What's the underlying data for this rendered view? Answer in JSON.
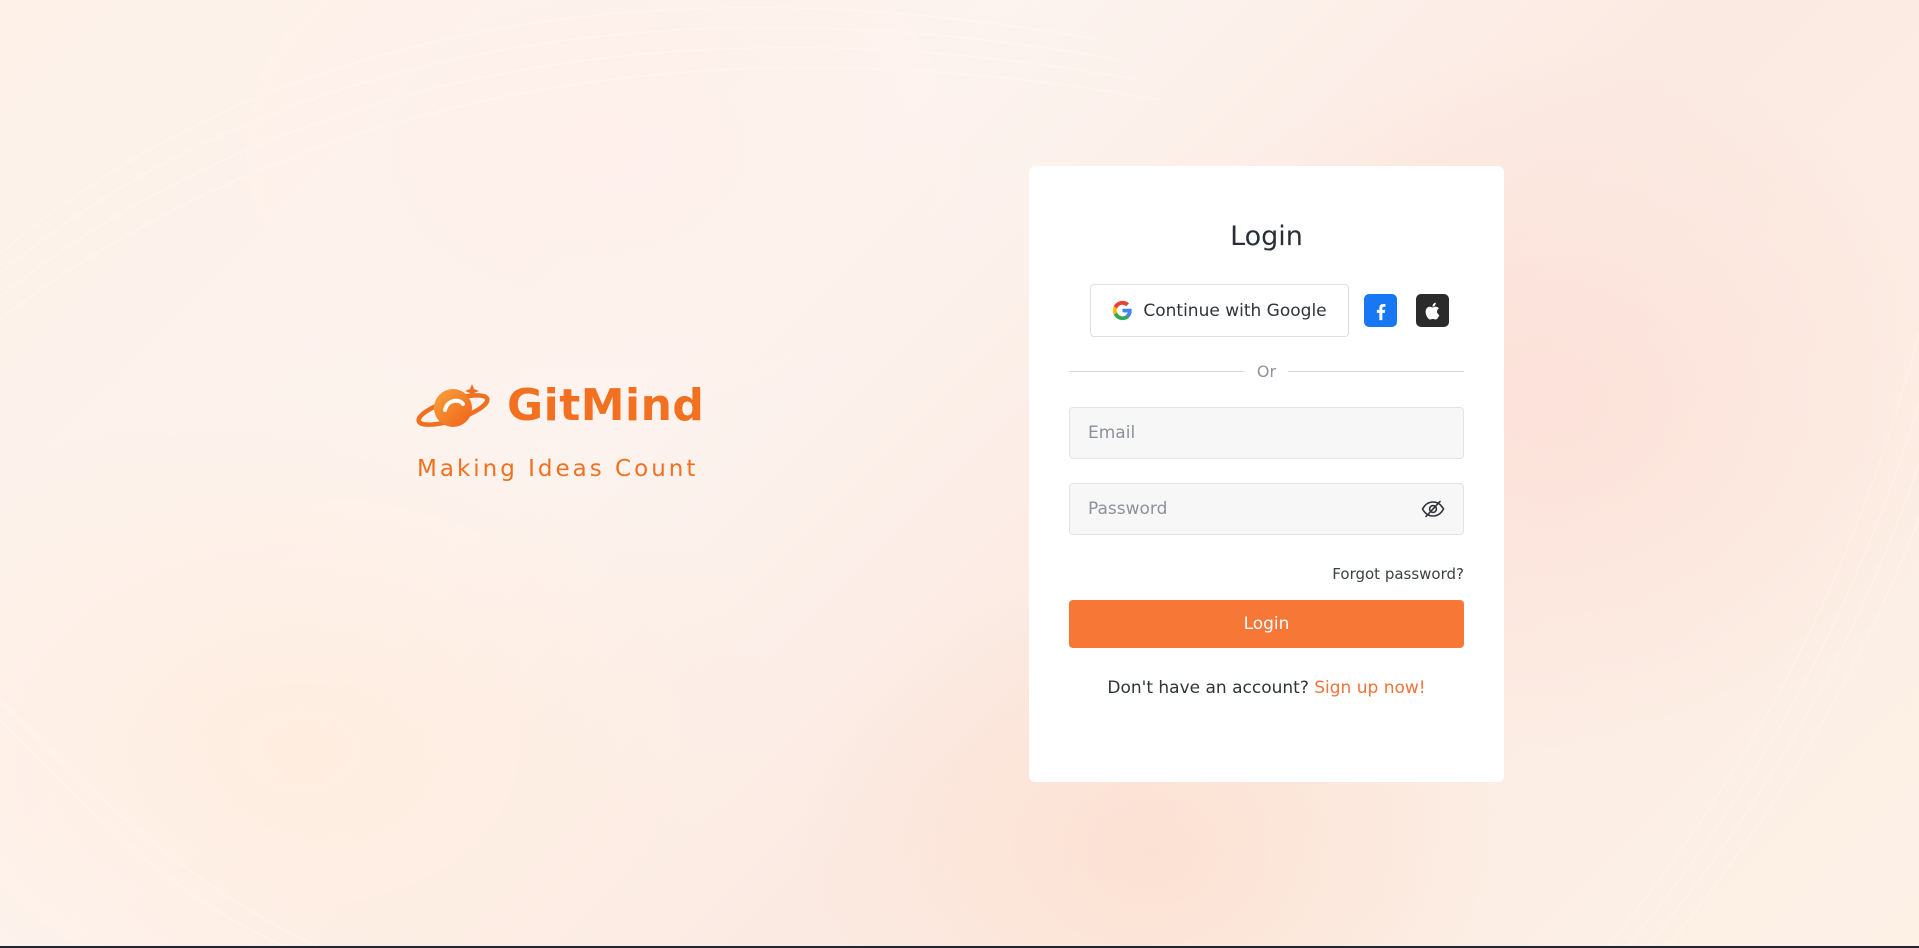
{
  "brand": {
    "name": "GitMind",
    "tagline": "Making Ideas Count",
    "color": "#f2701f"
  },
  "login": {
    "title": "Login",
    "google_label": "Continue with Google",
    "social_icons": [
      "google-icon",
      "facebook-icon",
      "apple-icon"
    ],
    "divider_text": "Or",
    "email_placeholder": "Email",
    "password_placeholder": "Password",
    "password_toggle_icon": "eye-slash-icon",
    "forgot_label": "Forgot password?",
    "submit_label": "Login",
    "signup_prompt": "Don't have an account?",
    "signup_link": "Sign up now!",
    "accent_color": "#f77737"
  }
}
